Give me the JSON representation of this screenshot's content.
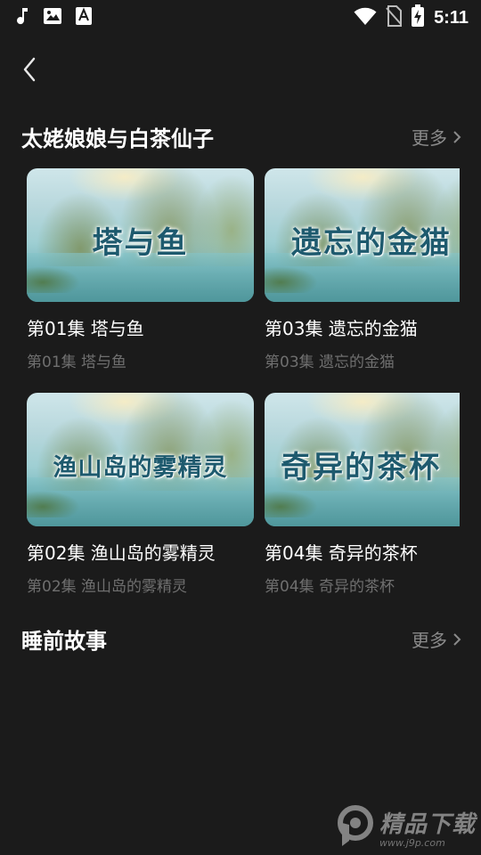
{
  "status_bar": {
    "time": "5:11"
  },
  "sections": [
    {
      "title": "太姥娘娘与白茶仙子",
      "more_label": "更多",
      "cards": [
        {
          "thumb_text": "塔与鱼",
          "title": "第01集 塔与鱼",
          "subtitle": "第01集 塔与鱼"
        },
        {
          "thumb_text": "遗忘的金猫",
          "title": "第03集 遗忘的金猫",
          "subtitle": "第03集 遗忘的金猫"
        },
        {
          "thumb_text": "渔山岛的雾精灵",
          "title": "第02集 渔山岛的雾精灵",
          "subtitle": "第02集 渔山岛的雾精灵"
        },
        {
          "thumb_text": "奇异的茶杯",
          "title": "第04集 奇异的茶杯",
          "subtitle": "第04集 奇异的茶杯"
        }
      ]
    },
    {
      "title": "睡前故事",
      "more_label": "更多"
    }
  ],
  "watermark": {
    "name": "精品下载",
    "url": "www.j9p.com"
  },
  "icons": [
    "music-note-icon",
    "image-icon",
    "font-icon",
    "wifi-icon",
    "no-sim-icon",
    "battery-charging-icon",
    "back-arrow-icon",
    "chevron-right-icon"
  ]
}
